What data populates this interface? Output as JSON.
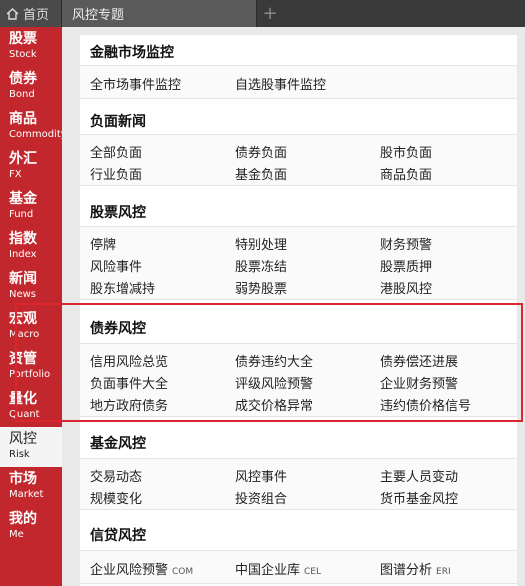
{
  "tabs": {
    "home_label": "首页",
    "active_label": "风控专题",
    "new_tab_symbol": "+"
  },
  "sidebar": {
    "items": [
      {
        "zh": "股票",
        "en": "Stock"
      },
      {
        "zh": "债券",
        "en": "Bond"
      },
      {
        "zh": "商品",
        "en": "Commodity"
      },
      {
        "zh": "外汇",
        "en": "FX"
      },
      {
        "zh": "基金",
        "en": "Fund"
      },
      {
        "zh": "指数",
        "en": "Index"
      },
      {
        "zh": "新闻",
        "en": "News"
      },
      {
        "zh": "宏观",
        "en": "Macro"
      },
      {
        "zh": "资管",
        "en": "Portfolio"
      },
      {
        "zh": "量化",
        "en": "Quant"
      },
      {
        "zh": "风控",
        "en": "Risk"
      },
      {
        "zh": "市场",
        "en": "Market"
      },
      {
        "zh": "我的",
        "en": "Me"
      }
    ],
    "active_index": 10
  },
  "sections": {
    "market": {
      "title": "金融市场监控",
      "links": [
        "全市场事件监控",
        "自选股事件监控"
      ]
    },
    "negative_news": {
      "title": "负面新闻",
      "links": [
        "全部负面",
        "债券负面",
        "股市负面",
        "行业负面",
        "基金负面",
        "商品负面"
      ]
    },
    "stock_risk": {
      "title": "股票风控",
      "links": [
        "停牌",
        "特别处理",
        "财务预警",
        "风险事件",
        "股票冻结",
        "股票质押",
        "股东增减持",
        "弱势股票",
        "港股风控"
      ]
    },
    "bond_risk": {
      "title": "债券风控",
      "links": [
        "信用风险总览",
        "债券违约大全",
        "债券偿还进展",
        "负面事件大全",
        "评级风险预警",
        "企业财务预警",
        "地方政府债务",
        "成交价格异常",
        "违约债价格信号"
      ]
    },
    "fund_risk": {
      "title": "基金风控",
      "links": [
        "交易动态",
        "风控事件",
        "主要人员变动",
        "规模变化",
        "投资组合",
        "货币基金风控"
      ]
    },
    "credit_risk": {
      "title": "信贷风控",
      "links": [
        {
          "label": "企业风险预警",
          "tag": "COM"
        },
        {
          "label": "中国企业库",
          "tag": "CEL"
        },
        {
          "label": "图谱分析",
          "tag": "ERI"
        }
      ]
    }
  },
  "colors": {
    "sidebar_bg": "#c1272d",
    "highlight_border": "#d9262f",
    "topbar_bg": "#3a3a3a"
  }
}
